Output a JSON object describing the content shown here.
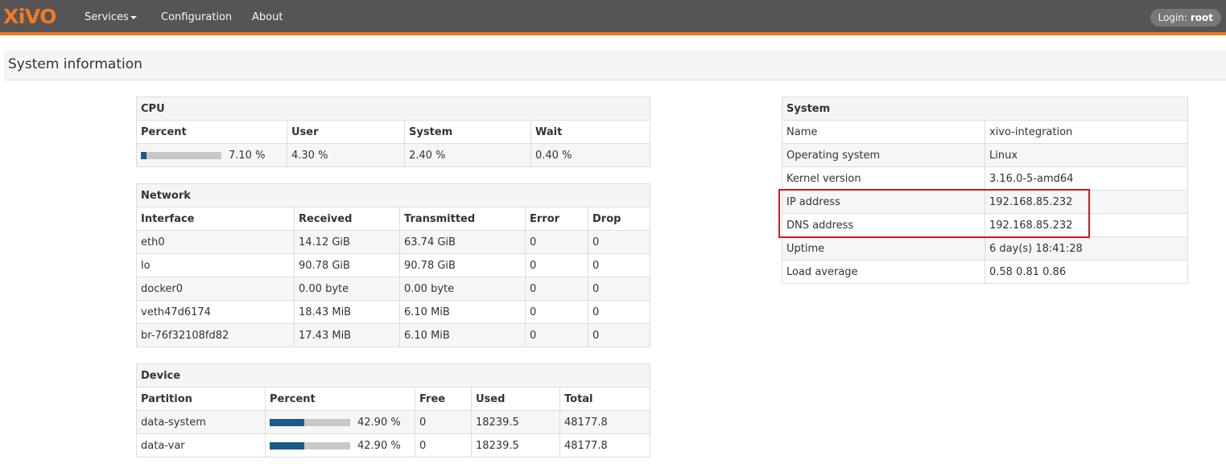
{
  "navbar": {
    "logo": "XiVO",
    "menu": [
      {
        "label": "Services",
        "dropdown": true
      },
      {
        "label": "Configuration",
        "dropdown": false
      },
      {
        "label": "About",
        "dropdown": false
      }
    ],
    "login_prefix": "Login: ",
    "login_user": "root"
  },
  "page": {
    "title": "System information"
  },
  "cpu": {
    "title": "CPU",
    "headers": [
      "Percent",
      "User",
      "System",
      "Wait"
    ],
    "percent": "7.10 %",
    "percent_value": 0.071,
    "user": "4.30 %",
    "system": "2.40 %",
    "wait": "0.40 %"
  },
  "network": {
    "title": "Network",
    "headers": [
      "Interface",
      "Received",
      "Transmitted",
      "Error",
      "Drop"
    ],
    "rows": [
      [
        "eth0",
        "14.12 GiB",
        "63.74 GiB",
        "0",
        "0"
      ],
      [
        "lo",
        "90.78 GiB",
        "90.78 GiB",
        "0",
        "0"
      ],
      [
        "docker0",
        "0.00 byte",
        "0.00 byte",
        "0",
        "0"
      ],
      [
        "veth47d6174",
        "18.43 MiB",
        "6.10 MiB",
        "0",
        "0"
      ],
      [
        "br-76f32108fd82",
        "17.43 MiB",
        "6.10 MiB",
        "0",
        "0"
      ]
    ]
  },
  "device": {
    "title": "Device",
    "headers": [
      "Partition",
      "Percent",
      "Free",
      "Used",
      "Total"
    ],
    "rows": [
      {
        "partition": "data-system",
        "percent": "42.90 %",
        "percent_value": 0.429,
        "free": "0",
        "used": "18239.5",
        "total": "48177.8"
      },
      {
        "partition": "data-var",
        "percent": "42.90 %",
        "percent_value": 0.429,
        "free": "0",
        "used": "18239.5",
        "total": "48177.8"
      }
    ]
  },
  "system": {
    "title": "System",
    "rows": [
      [
        "Name",
        "xivo-integration"
      ],
      [
        "Operating system",
        "Linux"
      ],
      [
        "Kernel version",
        "3.16.0-5-amd64"
      ],
      [
        "IP address",
        "192.168.85.232"
      ],
      [
        "DNS address",
        "192.168.85.232"
      ],
      [
        "Uptime",
        "6 day(s) 18:41:28"
      ],
      [
        "Load average",
        "0.58 0.81 0.86"
      ]
    ]
  },
  "colors": {
    "navbar_bg": "#555555",
    "accent": "#f37a20",
    "progress_fill": "#1b5a87",
    "highlight": "#cc1a1a"
  }
}
